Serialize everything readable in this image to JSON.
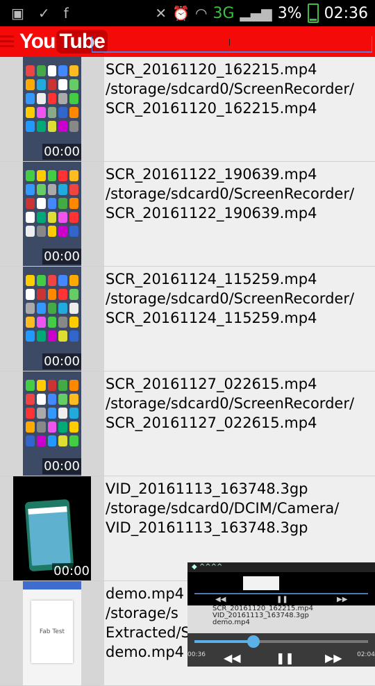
{
  "status_bar": {
    "battery_percent": "3%",
    "time": "02:36",
    "network": "3G"
  },
  "app_bar": {
    "logo_you": "You",
    "logo_tube": "Tube",
    "search_value": ""
  },
  "videos": [
    {
      "name": "SCR_20161120_162215.mp4",
      "path": "/storage/sdcard0/ScreenRecorder/",
      "file": "SCR_20161120_162215.mp4",
      "duration": "00:00",
      "thumb": "phone"
    },
    {
      "name": "SCR_20161122_190639.mp4",
      "path": "/storage/sdcard0/ScreenRecorder/",
      "file": "SCR_20161122_190639.mp4",
      "duration": "00:00",
      "thumb": "phone"
    },
    {
      "name": "SCR_20161124_115259.mp4",
      "path": "/storage/sdcard0/ScreenRecorder/",
      "file": "SCR_20161124_115259.mp4",
      "duration": "00:00",
      "thumb": "phone"
    },
    {
      "name": "SCR_20161127_022615.mp4",
      "path": "/storage/sdcard0/ScreenRecorder/",
      "file": "SCR_20161127_022615.mp4",
      "duration": "00:00",
      "thumb": "phone"
    },
    {
      "name": "VID_20161113_163748.3gp",
      "path": "/storage/sdcard0/DCIM/Camera/",
      "file": "VID_20161113_163748.3gp",
      "duration": "00:00",
      "thumb": "video"
    },
    {
      "name": "demo.mp4",
      "path": "/storage/s",
      "path2": "Extracted/S",
      "file": "demo.mp4",
      "duration": "",
      "thumb": "fab",
      "thumb_label": "Fab Test"
    }
  ],
  "mini_player": {
    "elapsed": "00:36",
    "total": "02:04",
    "progress_fraction": 0.34,
    "list_items": [
      "SCR_20161120_162215.mp4",
      "VID_20161113_163748.3gp",
      "demo.mp4"
    ]
  },
  "colors": {
    "youtube_red": "#f50a0a",
    "status_green": "#3fbf3f",
    "seek_blue": "#5bb0e8"
  }
}
